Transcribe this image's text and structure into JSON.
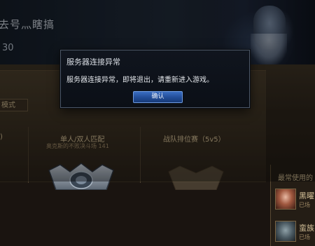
{
  "header": {
    "summoner_name": "去号灬瞎搞",
    "level": "30"
  },
  "main": {
    "mode_tab": "模式",
    "left_paren": ")",
    "queues": [
      {
        "title": "单人/双人匹配",
        "subtitle": "奥克斯的不败决斗场 141"
      },
      {
        "title": "战队排位赛（5v5）",
        "subtitle": ""
      }
    ]
  },
  "side_panel": {
    "title": "最常使用的",
    "champions": [
      {
        "name": "黑曜",
        "sub": "已场"
      },
      {
        "name": "蛮族",
        "sub": "已场"
      }
    ]
  },
  "dialog": {
    "title": "服务器连接异常",
    "message": "服务器连接异常，即将退出，请重新进入游戏。",
    "confirm_label": "确认"
  },
  "colors": {
    "accent_button": "#2a59a8",
    "gold_text": "#d4bf95",
    "dialog_bg": "#0d1119"
  }
}
